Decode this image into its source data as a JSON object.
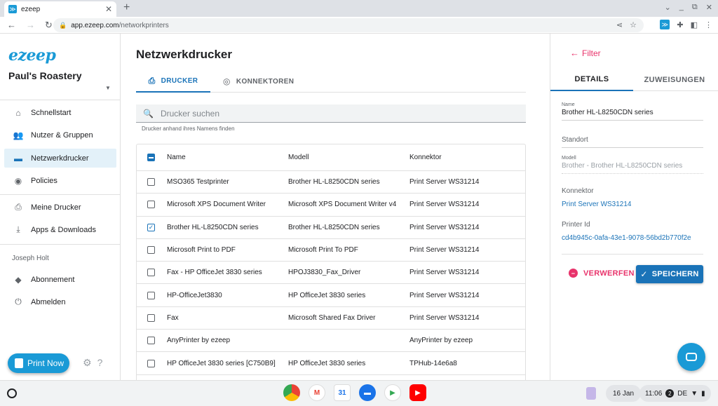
{
  "browser": {
    "tab_title": "ezeep",
    "url_host": "app.ezeep.com",
    "url_path": "/networkprinters"
  },
  "sidebar": {
    "logo": "ezeep",
    "org_name": "Paul's Roastery",
    "items": [
      {
        "label": "Schnellstart",
        "icon": "home-icon"
      },
      {
        "label": "Nutzer & Gruppen",
        "icon": "people-icon"
      },
      {
        "label": "Netzwerkdrucker",
        "icon": "network-printer-icon",
        "active": true
      },
      {
        "label": "Policies",
        "icon": "toggle-icon"
      },
      {
        "label": "Meine Drucker",
        "icon": "printer-icon"
      },
      {
        "label": "Apps & Downloads",
        "icon": "download-icon"
      }
    ],
    "user_name": "Joseph Holt",
    "account_items": [
      {
        "label": "Abonnement",
        "icon": "tag-icon"
      },
      {
        "label": "Abmelden",
        "icon": "power-icon"
      }
    ],
    "print_now_label": "Print Now"
  },
  "main": {
    "title": "Netzwerkdrucker",
    "tabs": [
      {
        "label": "DRUCKER",
        "active": true
      },
      {
        "label": "KONNEKTOREN",
        "active": false
      }
    ],
    "search": {
      "placeholder": "Drucker suchen",
      "hint": "Drucker anhand ihres Namens finden"
    },
    "table": {
      "columns": [
        "Name",
        "Modell",
        "Konnektor"
      ],
      "rows": [
        {
          "name": "MSO365 Testprinter",
          "model": "Brother HL-L8250CDN series",
          "connector": "Print Server WS31214",
          "checked": false
        },
        {
          "name": "Microsoft XPS Document Writer",
          "model": "Microsoft XPS Document Writer v4",
          "connector": "Print Server WS31214",
          "checked": false
        },
        {
          "name": "Brother HL-L8250CDN series",
          "model": "Brother HL-L8250CDN series",
          "connector": "Print Server WS31214",
          "checked": true
        },
        {
          "name": "Microsoft Print to PDF",
          "model": "Microsoft Print To PDF",
          "connector": "Print Server WS31214",
          "checked": false
        },
        {
          "name": "Fax - HP OfficeJet 3830 series",
          "model": "HPOJ3830_Fax_Driver",
          "connector": "Print Server WS31214",
          "checked": false
        },
        {
          "name": "HP-OfficeJet3830",
          "model": "HP OfficeJet 3830 series",
          "connector": "Print Server WS31214",
          "checked": false
        },
        {
          "name": "Fax",
          "model": "Microsoft Shared Fax Driver",
          "connector": "Print Server WS31214",
          "checked": false
        },
        {
          "name": "AnyPrinter by ezeep",
          "model": "",
          "connector": "AnyPrinter by ezeep",
          "checked": false
        },
        {
          "name": "HP OfficeJet 3830 series [C750B9]",
          "model": "HP OfficeJet 3830 series",
          "connector": "TPHub-14e6a8",
          "checked": false
        }
      ]
    }
  },
  "panel": {
    "back_label": "Filter",
    "tabs": [
      "DETAILS",
      "ZUWEISUNGEN"
    ],
    "name_label": "Name",
    "name_value": "Brother HL-L8250CDN series",
    "location_placeholder": "Standort",
    "model_label": "Modell",
    "model_value": "Brother - Brother HL-L8250CDN series",
    "connector_label": "Konnektor",
    "connector_value": "Print Server WS31214",
    "printer_id_label": "Printer Id",
    "printer_id_value": "cd4b945c-0afa-43e1-9078-56bd2b770f2e",
    "discard_label": "VERWERFEN",
    "save_label": "SPEICHERN"
  },
  "shelf": {
    "date": "16 Jan",
    "time": "11:06",
    "notif_count": "2",
    "locale": "DE"
  },
  "colors": {
    "accent": "#1a73b8",
    "brand": "#1a9ad6",
    "danger": "#e8336b"
  }
}
